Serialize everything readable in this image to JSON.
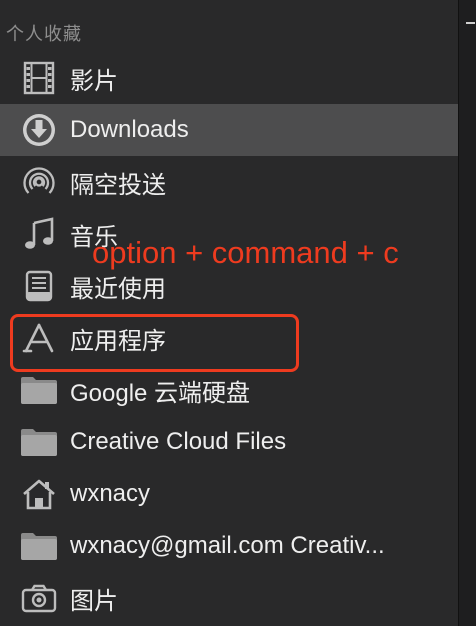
{
  "sidebar": {
    "section_title": "个人收藏",
    "items": [
      {
        "label": "影片",
        "icon": "film-icon"
      },
      {
        "label": "Downloads",
        "icon": "download-icon",
        "selected": true
      },
      {
        "label": "隔空投送",
        "icon": "airdrop-icon"
      },
      {
        "label": "音乐",
        "icon": "music-note-icon"
      },
      {
        "label": "最近使用",
        "icon": "recents-icon"
      },
      {
        "label": "应用程序",
        "icon": "applications-icon"
      },
      {
        "label": "Google 云端硬盘",
        "icon": "folder-icon"
      },
      {
        "label": "Creative Cloud Files",
        "icon": "folder-icon"
      },
      {
        "label": "wxnacy",
        "icon": "home-icon"
      },
      {
        "label": "wxnacy@gmail.com Creativ...",
        "icon": "folder-icon"
      },
      {
        "label": "图片",
        "icon": "camera-icon"
      }
    ]
  },
  "annotation": {
    "text": "option + command + c",
    "color": "#ee3b1f"
  },
  "colors": {
    "sidebar_bg": "#29292a",
    "selected_bg": "#4d4d4e",
    "text": "#eeeeee",
    "section_title": "#8e8e8e"
  }
}
